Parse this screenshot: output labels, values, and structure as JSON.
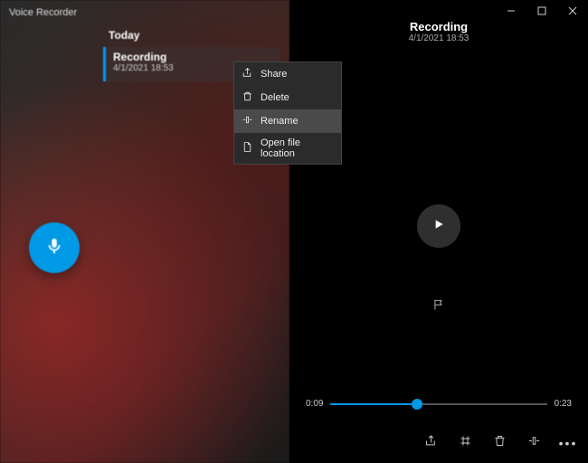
{
  "app_title": "Voice Recorder",
  "sidebar": {
    "group_header": "Today",
    "item": {
      "title": "Recording",
      "date": "4/1/2021 18:53"
    }
  },
  "context_menu": {
    "share": "Share",
    "delete": "Delete",
    "rename": "Rename",
    "open_location": "Open file location"
  },
  "detail": {
    "title": "Recording",
    "date": "4/1/2021 18:53"
  },
  "playback": {
    "current": "0:09",
    "total": "0:23"
  }
}
